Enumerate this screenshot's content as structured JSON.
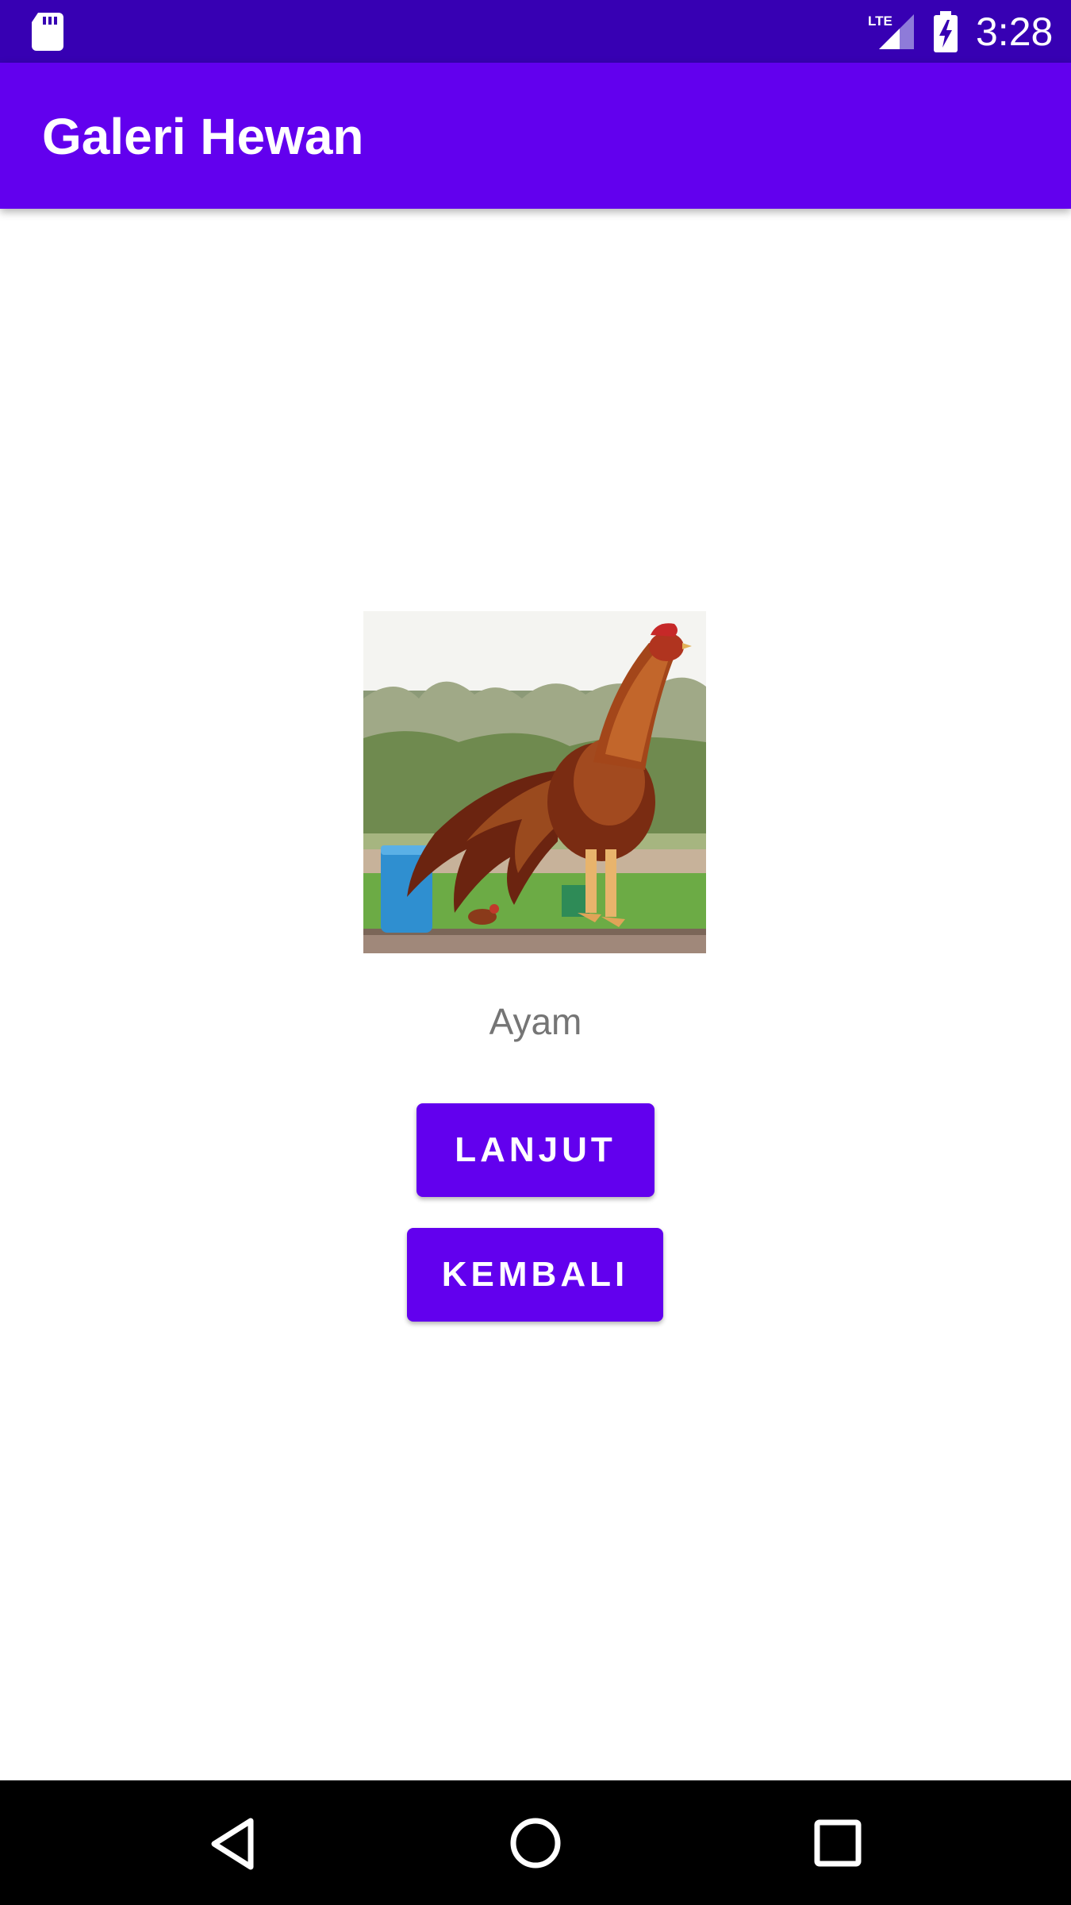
{
  "status_bar": {
    "time": "3:28",
    "network": "LTE",
    "icons": [
      "sd-card-icon",
      "lte-signal-icon",
      "battery-charging-icon"
    ]
  },
  "app_bar": {
    "title": "Galeri Hewan",
    "color": "#6200ee"
  },
  "content": {
    "animal_image": "rooster-photo",
    "animal_name": "Ayam",
    "next_button": "LANJUT",
    "back_button": "KEMBALI"
  },
  "nav_bar": {
    "icons": [
      "back-triangle-icon",
      "home-circle-icon",
      "recents-square-icon"
    ]
  },
  "colors": {
    "status_bar": "#3700b3",
    "primary": "#6200ee",
    "text_secondary": "#757575"
  }
}
